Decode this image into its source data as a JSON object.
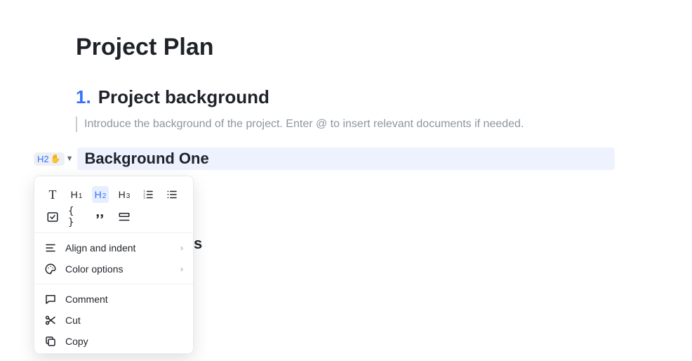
{
  "doc": {
    "title": "Project Plan",
    "h1_number": "1.",
    "h1_text": "Project background",
    "placeholder": "Introduce the background of the project. Enter @ to insert relevant documents if needed.",
    "h2_highlighted": "Background One"
  },
  "handle": {
    "badge": "H2",
    "caret": "▼"
  },
  "format_toolbar": {
    "text": "T",
    "h1": "H",
    "h1_sub": "1",
    "h2": "H",
    "h2_sub": "2",
    "h3": "H",
    "h3_sub": "3",
    "code": "{ }",
    "quote": "❝❞"
  },
  "menu": {
    "align_indent": "Align and indent",
    "color_options": "Color options",
    "comment": "Comment",
    "cut": "Cut",
    "copy": "Copy"
  },
  "ghost": "s"
}
